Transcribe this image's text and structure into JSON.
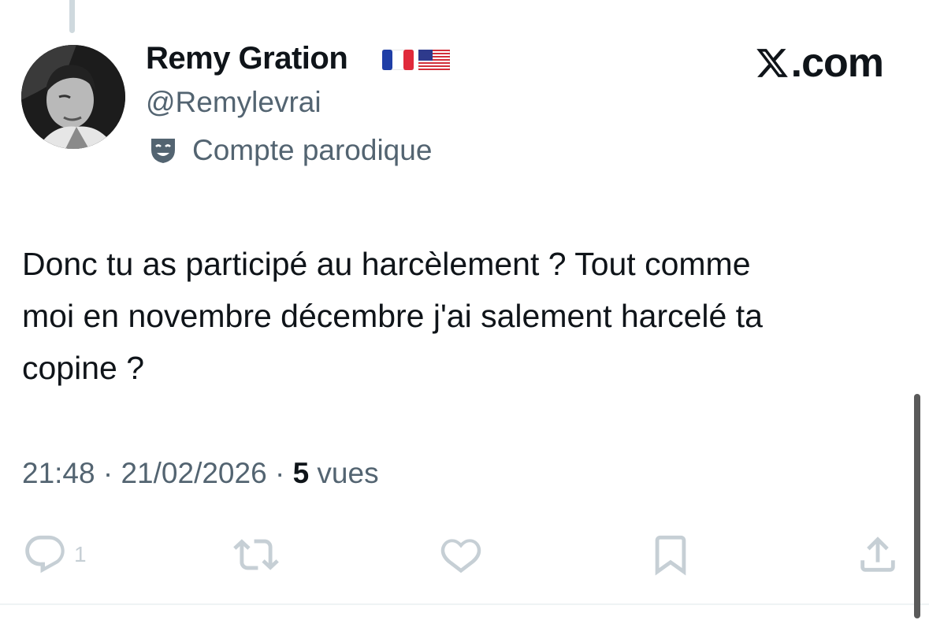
{
  "tweet": {
    "author": {
      "display_name": "Remy Gration",
      "flags": [
        "france-flag",
        "usa-flag"
      ],
      "handle": "@Remylevrai",
      "parody_label": "Compte parodique"
    },
    "brand": ".com",
    "text": "Donc tu as participé au harcèlement ? Tout comme moi en novembre décembre j'ai salement harcelé ta copine ?",
    "time": "21:48",
    "date": "21/02/2026",
    "separator": " · ",
    "views_count": "5",
    "views_label": " vues",
    "actions": {
      "reply_count": "1",
      "reply_icon": "reply-icon",
      "retweet_icon": "retweet-icon",
      "like_icon": "heart-icon",
      "bookmark_icon": "bookmark-icon",
      "share_icon": "share-icon"
    }
  },
  "colors": {
    "text": "#0f1419",
    "secondary": "#536471",
    "action_icons": "#c6cfd5",
    "thread_line": "#cfd9de"
  }
}
